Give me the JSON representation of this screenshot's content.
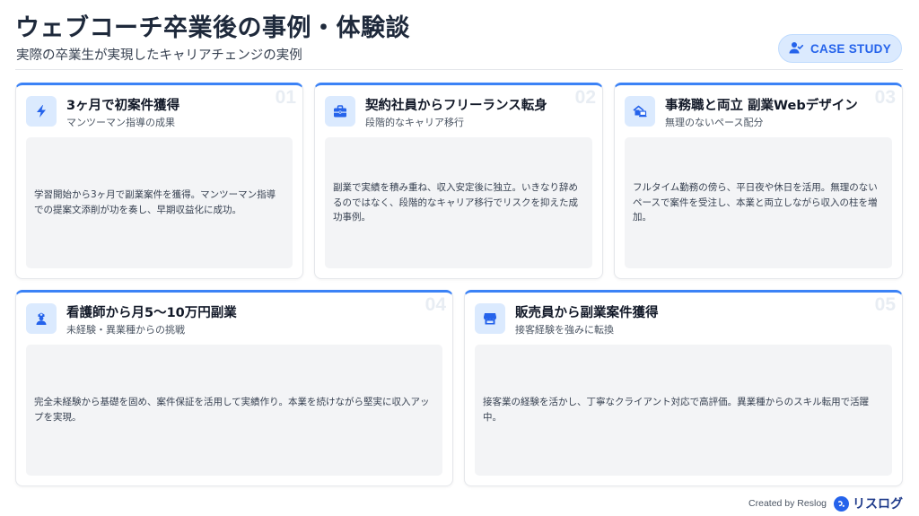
{
  "header": {
    "title": "ウェブコーチ卒業後の事例・体験談",
    "subtitle": "実際の卒業生が実現したキャリアチェンジの実例",
    "badge_label": "CASE STUDY",
    "badge_icon": "user-check-icon"
  },
  "accent_color": "#3b82f6",
  "cards": [
    {
      "number": "01",
      "icon": "lightning-bolt-icon",
      "title": "3ヶ月で初案件獲得",
      "subtitle": "マンツーマン指導の成果",
      "body": "学習開始から3ヶ月で副業案件を獲得。マンツーマン指導での提案文添削が功を奏し、早期収益化に成功。"
    },
    {
      "number": "02",
      "icon": "briefcase-icon",
      "title": "契約社員からフリーランス転身",
      "subtitle": "段階的なキャリア移行",
      "body": "副業で実績を積み重ね、収入安定後に独立。いきなり辞めるのではなく、段階的なキャリア移行でリスクを抑えた成功事例。"
    },
    {
      "number": "03",
      "icon": "house-laptop-icon",
      "title": "事務職と両立 副業Webデザイン",
      "subtitle": "無理のないペース配分",
      "body": "フルタイム勤務の傍ら、平日夜や休日を活用。無理のないペースで案件を受注し、本業と両立しながら収入の柱を増加。"
    },
    {
      "number": "04",
      "icon": "nurse-icon",
      "title": "看護師から月5〜10万円副業",
      "subtitle": "未経験・異業種からの挑戦",
      "body": "完全未経験から基礎を固め、案件保証を活用して実績作り。本業を続けながら堅実に収入アップを実現。"
    },
    {
      "number": "05",
      "icon": "store-icon",
      "title": "販売員から副業案件獲得",
      "subtitle": "接客経験を強みに転換",
      "body": "接客業の経験を活かし、丁寧なクライアント対応で高評価。異業種からのスキル転用で活躍中。"
    }
  ],
  "footer": {
    "credit": "Created by Reslog",
    "logo_text": "リスログ",
    "logo_icon": "reslog-logo-icon"
  }
}
